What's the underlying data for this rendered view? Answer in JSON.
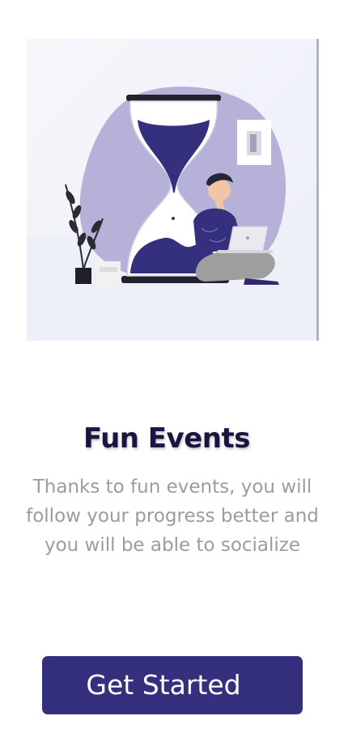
{
  "onboarding": {
    "title": "Fun Events",
    "description": "Thanks to fun events, you will follow your progress better and you will be able to socialize",
    "cta_label": "Get Started"
  },
  "colors": {
    "primary": "#35307d",
    "title": "#1c1440",
    "description": "#9c9c9c",
    "illustration_accent": "#b6b1d9",
    "illustration_dark": "#38307f"
  },
  "illustration": {
    "icon": "hourglass-person-laptop-illustration"
  }
}
